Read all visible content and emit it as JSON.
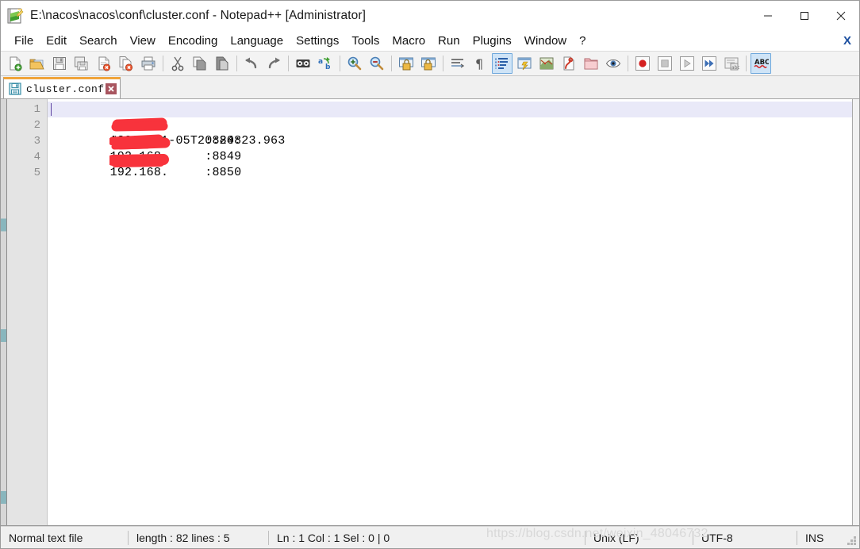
{
  "window": {
    "title": "E:\\nacos\\nacos\\conf\\cluster.conf - Notepad++ [Administrator]",
    "icon": "notepad-plus-plus-icon",
    "controls": [
      {
        "name": "minimize-button",
        "label": "Minimize"
      },
      {
        "name": "maximize-button",
        "label": "Maximize"
      },
      {
        "name": "close-button",
        "label": "Close"
      }
    ]
  },
  "menubar": {
    "items": [
      {
        "label": "File"
      },
      {
        "label": "Edit"
      },
      {
        "label": "Search"
      },
      {
        "label": "View"
      },
      {
        "label": "Encoding"
      },
      {
        "label": "Language"
      },
      {
        "label": "Settings"
      },
      {
        "label": "Tools"
      },
      {
        "label": "Macro"
      },
      {
        "label": "Run"
      },
      {
        "label": "Plugins"
      },
      {
        "label": "Window"
      },
      {
        "label": "?"
      }
    ],
    "close_document": "X"
  },
  "toolbar": {
    "buttons": [
      {
        "name": "new-file-icon",
        "tip": "New"
      },
      {
        "name": "open-file-icon",
        "tip": "Open"
      },
      {
        "name": "save-icon",
        "tip": "Save"
      },
      {
        "name": "save-all-icon",
        "tip": "Save All"
      },
      {
        "name": "close-document-icon",
        "tip": "Close"
      },
      {
        "name": "close-all-documents-icon",
        "tip": "Close All"
      },
      {
        "name": "print-icon",
        "tip": "Print"
      },
      {
        "name": "separator",
        "tip": ""
      },
      {
        "name": "cut-icon",
        "tip": "Cut"
      },
      {
        "name": "copy-icon",
        "tip": "Copy"
      },
      {
        "name": "paste-icon",
        "tip": "Paste"
      },
      {
        "name": "separator",
        "tip": ""
      },
      {
        "name": "undo-icon",
        "tip": "Undo"
      },
      {
        "name": "redo-icon",
        "tip": "Redo"
      },
      {
        "name": "separator",
        "tip": ""
      },
      {
        "name": "find-icon",
        "tip": "Find"
      },
      {
        "name": "replace-icon",
        "tip": "Replace"
      },
      {
        "name": "separator",
        "tip": ""
      },
      {
        "name": "zoom-in-icon",
        "tip": "Zoom In"
      },
      {
        "name": "zoom-out-icon",
        "tip": "Zoom Out"
      },
      {
        "name": "separator",
        "tip": ""
      },
      {
        "name": "sync-vertical-scroll-icon",
        "tip": "Synchronize Vertical Scrolling"
      },
      {
        "name": "sync-horizontal-scroll-icon",
        "tip": "Synchronize Horizontal Scrolling"
      },
      {
        "name": "separator",
        "tip": ""
      },
      {
        "name": "word-wrap-icon",
        "tip": "Word wrap"
      },
      {
        "name": "show-all-characters-icon",
        "tip": "Show All Characters"
      },
      {
        "name": "indent-guide-icon",
        "tip": "Show Indent Guide",
        "active": true
      },
      {
        "name": "user-defined-dialog-icon",
        "tip": "User Defined Dialogue"
      },
      {
        "name": "document-map-icon",
        "tip": "Document Map"
      },
      {
        "name": "function-list-icon",
        "tip": "Function List"
      },
      {
        "name": "folder-as-workspace-icon",
        "tip": "Folder as Workspace"
      },
      {
        "name": "monitoring-icon",
        "tip": "Monitoring"
      },
      {
        "name": "separator",
        "tip": ""
      },
      {
        "name": "record-macro-icon",
        "tip": "Start Recording"
      },
      {
        "name": "stop-macro-icon",
        "tip": "Stop Recording"
      },
      {
        "name": "play-macro-icon",
        "tip": "Playback"
      },
      {
        "name": "run-macro-multiple-icon",
        "tip": "Run a Macro Multiple Times"
      },
      {
        "name": "save-macro-icon",
        "tip": "Save Current Recorded Macro"
      },
      {
        "name": "separator",
        "tip": ""
      },
      {
        "name": "spell-check-icon",
        "tip": "ABC",
        "active": true,
        "label": "ABC"
      }
    ]
  },
  "tabs": [
    {
      "label": "cluster.conf",
      "active": true,
      "icon": "saved-file-icon",
      "close": "x"
    }
  ],
  "editor": {
    "line_numbers": [
      "1",
      "2",
      "3",
      "4",
      "5"
    ],
    "lines": [
      {
        "text": "#2020-11-05T20:20:23.963",
        "current": true,
        "redacted": false
      },
      {
        "prefix": "192.168.",
        "suffix": ":8848",
        "redacted": true
      },
      {
        "prefix": "192.168.",
        "suffix": ":8849",
        "redacted": true
      },
      {
        "prefix": "192.168.",
        "suffix": ":8850",
        "redacted": true
      },
      {
        "text": "",
        "current": false,
        "redacted": false
      }
    ],
    "redaction_color": "#f8333c"
  },
  "statusbar": {
    "file_type": "Normal text file",
    "length_lines": "length : 82    lines : 5",
    "position": "Ln : 1    Col : 1    Sel : 0 | 0",
    "eol": "Unix (LF)",
    "encoding": "UTF-8",
    "insert_mode": "INS"
  },
  "watermark": "https://blog.csdn.net/weixin_48046732",
  "colors": {
    "tab_active_top": "#f0a43a",
    "current_line": "#e9e9f8",
    "gutter_bg": "#e4e4e4",
    "toolbar_bg": "#f3f3f3",
    "accent_blue": "#6fa8dc",
    "redaction": "#f8333c"
  }
}
